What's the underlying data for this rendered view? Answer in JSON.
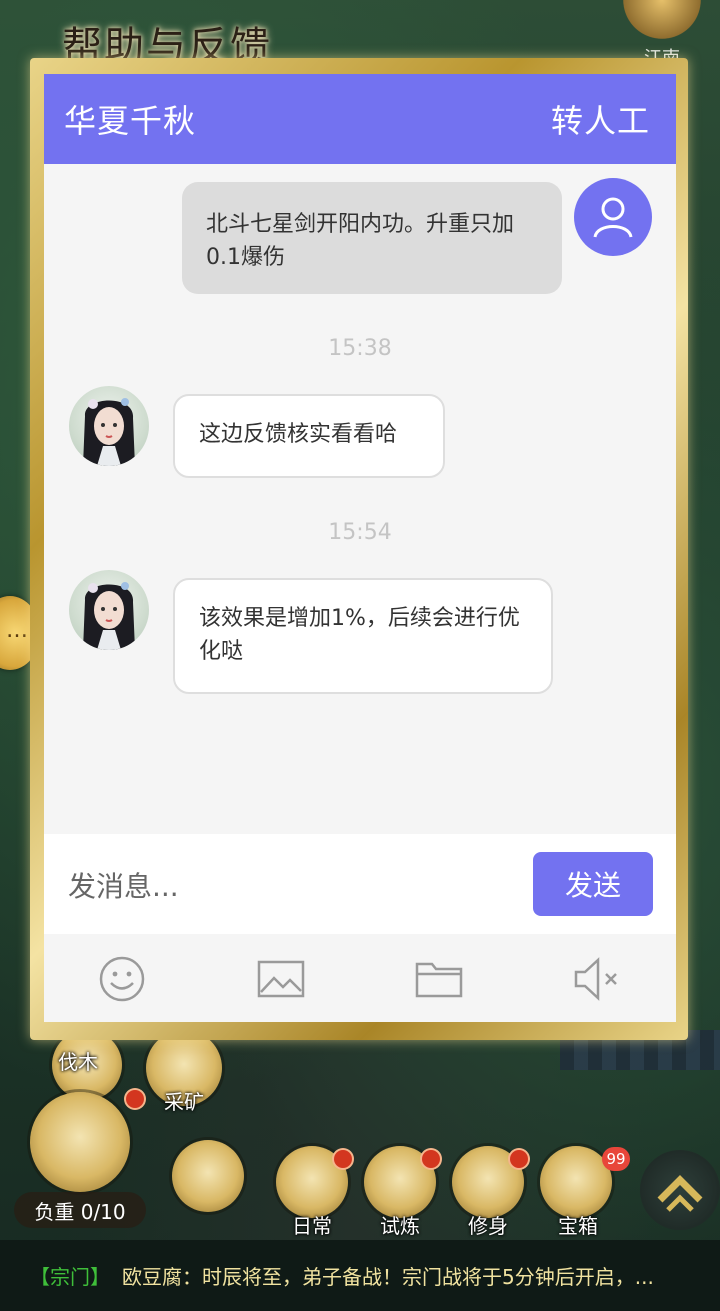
{
  "page_title": "帮助与反馈",
  "region": "江南",
  "header": {
    "title": "华夏千秋",
    "transfer_label": "转人工"
  },
  "messages": [
    {
      "sender": "user",
      "text": "北斗七星剑开阳内功。升重只加0.1爆伤"
    },
    {
      "type": "time",
      "text": "15:38"
    },
    {
      "sender": "agent",
      "text": "这边反馈核实看看哈"
    },
    {
      "type": "time",
      "text": "15:54"
    },
    {
      "sender": "agent",
      "text": "该效果是增加1%，后续会进行优化哒"
    }
  ],
  "input": {
    "placeholder": "发消息...",
    "value": ""
  },
  "send_label": "发送",
  "toolbar": {
    "icons": [
      "emoji-icon",
      "image-icon",
      "folder-icon",
      "mute-icon"
    ]
  },
  "game": {
    "buttons": [
      "伐木",
      "采矿",
      "日常",
      "试炼",
      "修身",
      "宝箱"
    ],
    "load_label": "负重 0/10",
    "chest_badge": "99",
    "ticker_tag": "【宗门】",
    "ticker_text": "欧豆腐：时辰将至，弟子备战！宗门战将于5分钟后开启，..."
  },
  "colors": {
    "accent": "#7372f0",
    "frame_gold": "#d4b24a"
  }
}
